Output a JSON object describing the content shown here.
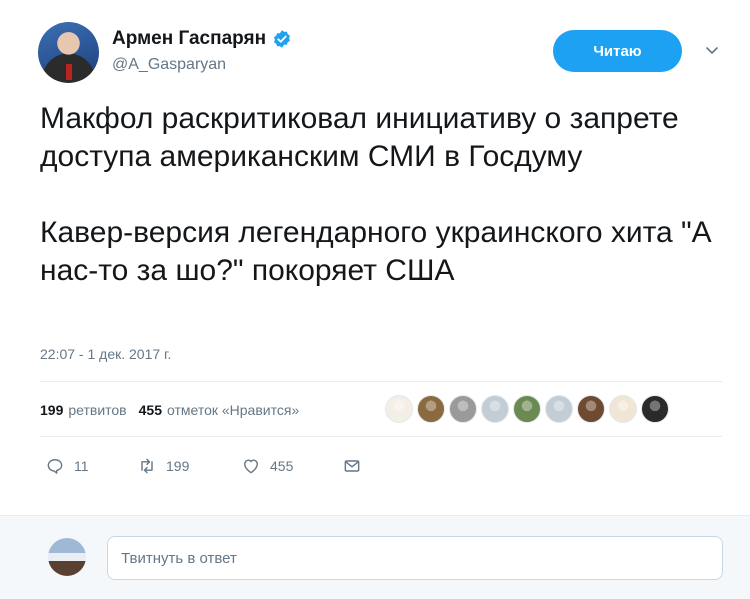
{
  "user": {
    "display_name": "Армен Гаспарян",
    "handle": "@A_Gasparyan",
    "verified": true
  },
  "follow_button": {
    "label": "Читаю"
  },
  "tweet": {
    "text": "Макфол раскритиковал инициативу о запрете доступа американским СМИ в Госдуму\n\nКавер-версия легендарного украинского хита \"А нас-то за шо?\" покоряет США",
    "timestamp": "22:07 - 1 дек. 2017 г."
  },
  "stats": {
    "retweets_count": "199",
    "retweets_label": "ретвитов",
    "likes_count": "455",
    "likes_label": "отметок «Нравится»"
  },
  "likers": [
    {
      "icon": "avatar-dog",
      "color": "#f3efe6"
    },
    {
      "icon": "avatar-woman",
      "color": "#8a6a3e"
    },
    {
      "icon": "avatar-photo",
      "color": "#9a9a9a"
    },
    {
      "icon": "avatar-default",
      "color": "#c3cdd6"
    },
    {
      "icon": "avatar-people",
      "color": "#6b8a52"
    },
    {
      "icon": "avatar-default",
      "color": "#c3cdd6"
    },
    {
      "icon": "avatar-brown",
      "color": "#6e4a30"
    },
    {
      "icon": "avatar-rooster",
      "color": "#f1e6d6"
    },
    {
      "icon": "avatar-cat",
      "color": "#2a2a2a"
    }
  ],
  "actions": {
    "reply_count": "11",
    "retweet_count": "199",
    "like_count": "455"
  },
  "reply": {
    "placeholder": "Твитнуть в ответ"
  },
  "colors": {
    "accent": "#1da1f2",
    "text": "#14171a",
    "muted": "#657786"
  }
}
